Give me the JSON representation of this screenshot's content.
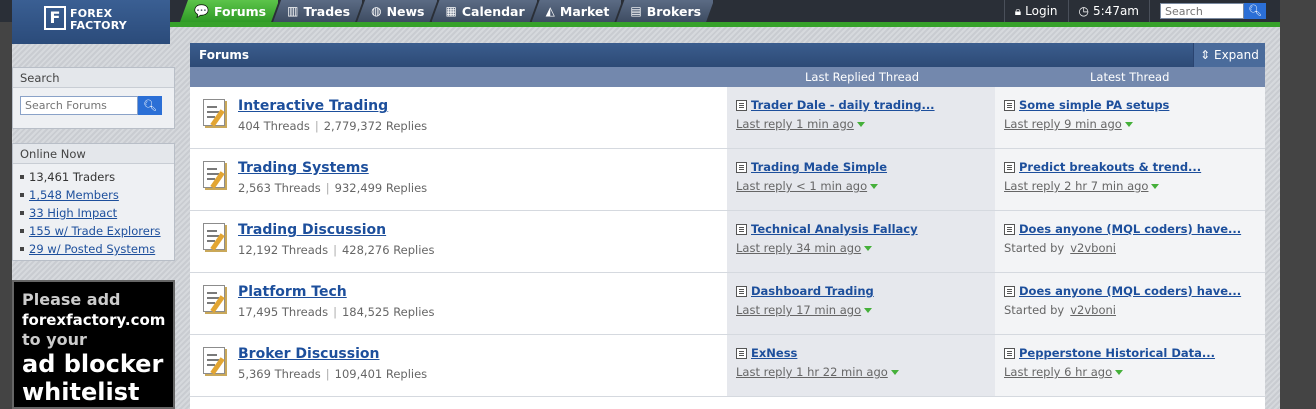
{
  "logo": {
    "mark": "F",
    "line1": "FOREX",
    "line2": "FACTORY"
  },
  "nav": [
    {
      "label": "Forums",
      "icon": "chat-icon"
    },
    {
      "label": "Trades",
      "icon": "bars-icon"
    },
    {
      "label": "News",
      "icon": "globe-icon"
    },
    {
      "label": "Calendar",
      "icon": "calendar-icon"
    },
    {
      "label": "Market",
      "icon": "chart-icon"
    },
    {
      "label": "Brokers",
      "icon": "building-icon"
    }
  ],
  "topright": {
    "login": "Login",
    "time": "5:47am",
    "search_placeholder": "Search"
  },
  "sidebar": {
    "search_title": "Search",
    "search_placeholder": "Search Forums",
    "online_title": "Online Now",
    "online_items": [
      "13,461 Traders",
      "1,548 Members",
      "33 High Impact",
      "155 w/ Trade Explorers",
      "29 w/ Posted Systems"
    ]
  },
  "ad": {
    "line1": "Please add",
    "line2": "forexfactory.com",
    "line3": "to your",
    "line4": "ad blocker",
    "line5": "whitelist"
  },
  "panel": {
    "title": "Forums",
    "expand": "Expand",
    "col_last_replied": "Last Replied Thread",
    "col_latest": "Latest Thread"
  },
  "forums": [
    {
      "title": "Interactive Trading",
      "threads": "404 Threads",
      "replies": "2,779,372 Replies",
      "replied_title": "Trader Dale - daily trading...",
      "replied_sub": "Last reply 1 min ago",
      "latest_title": "Some simple PA setups",
      "latest_sub": "Last reply 9 min ago",
      "latest_user": ""
    },
    {
      "title": "Trading Systems",
      "threads": "2,563 Threads",
      "replies": "932,499 Replies",
      "replied_title": "Trading Made Simple",
      "replied_sub": "Last reply < 1 min ago",
      "latest_title": "Predict breakouts & trend...",
      "latest_sub": "Last reply 2 hr 7 min ago",
      "latest_user": ""
    },
    {
      "title": "Trading Discussion",
      "threads": "12,192 Threads",
      "replies": "428,276 Replies",
      "replied_title": "Technical Analysis Fallacy",
      "replied_sub": "Last reply 34 min ago",
      "latest_title": "Does anyone (MQL coders) have...",
      "latest_sub": "Started by",
      "latest_user": "v2vboni"
    },
    {
      "title": "Platform Tech",
      "threads": "17,495 Threads",
      "replies": "184,525 Replies",
      "replied_title": "Dashboard Trading",
      "replied_sub": "Last reply 17 min ago",
      "latest_title": "Does anyone (MQL coders) have...",
      "latest_sub": "Started by",
      "latest_user": "v2vboni"
    },
    {
      "title": "Broker Discussion",
      "threads": "5,369 Threads",
      "replies": "109,401 Replies",
      "replied_title": "ExNess",
      "replied_sub": "Last reply 1 hr 22 min ago",
      "latest_title": "Pepperstone Historical Data...",
      "latest_sub": "Last reply 6 hr ago",
      "latest_user": ""
    }
  ]
}
